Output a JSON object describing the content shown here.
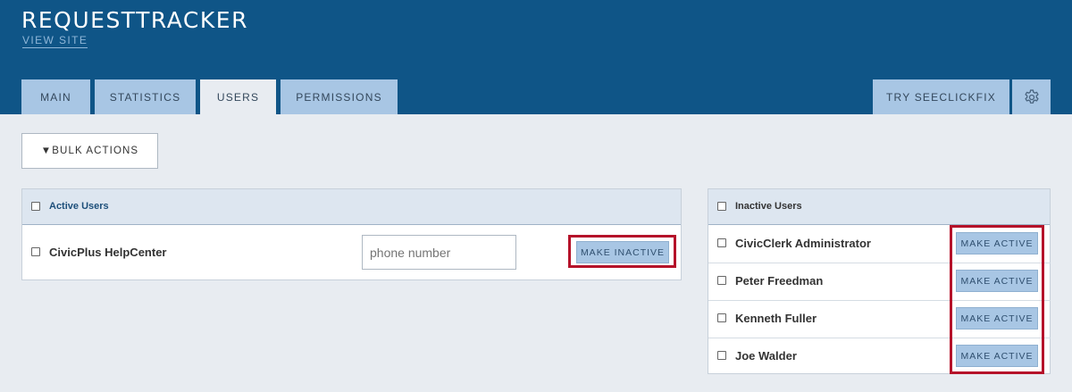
{
  "app": {
    "title": "REQUESTTRACKER",
    "view_site": "VIEW SITE"
  },
  "tabs": [
    {
      "label": "MAIN"
    },
    {
      "label": "STATISTICS"
    },
    {
      "label": "USERS",
      "active": true
    },
    {
      "label": "PERMISSIONS"
    }
  ],
  "right_tabs": {
    "try_label": "TRY SEECLICKFIX",
    "settings_icon": "gear-icon"
  },
  "bulk_actions": {
    "label": "▼BULK ACTIONS"
  },
  "active_users": {
    "heading": "Active Users",
    "rows": [
      {
        "name": "CivicPlus HelpCenter",
        "phone_placeholder": "phone number",
        "action": "MAKE INACTIVE"
      }
    ]
  },
  "inactive_users": {
    "heading": "Inactive Users",
    "rows": [
      {
        "name": "CivicClerk Administrator",
        "action": "MAKE ACTIVE"
      },
      {
        "name": "Peter Freedman",
        "action": "MAKE ACTIVE"
      },
      {
        "name": "Kenneth Fuller",
        "action": "MAKE ACTIVE"
      },
      {
        "name": "Joe Walder",
        "action": "MAKE ACTIVE"
      }
    ]
  },
  "colors": {
    "header_bg": "#0f5587",
    "tab_bg": "#a8c6e4",
    "page_bg": "#e8ecf1",
    "highlight": "#b5122a"
  }
}
